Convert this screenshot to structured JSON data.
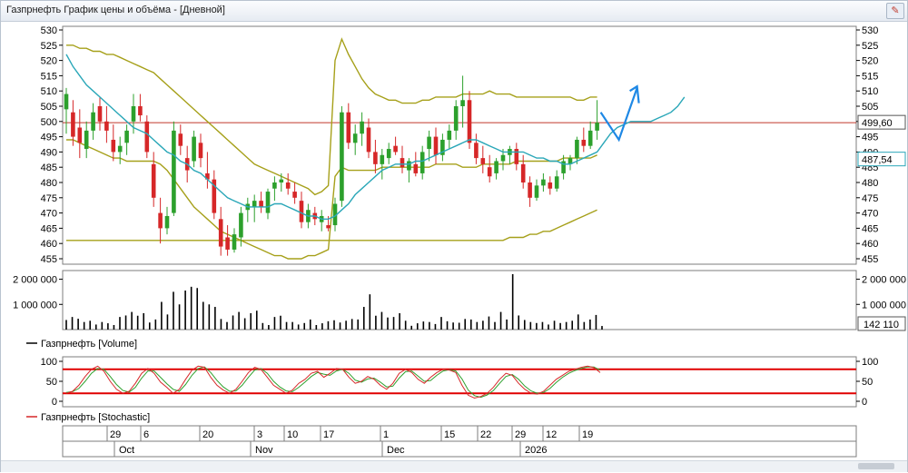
{
  "window": {
    "title": "Газпрнефть График цены и объёма - [Дневной]"
  },
  "colors": {
    "up": "#2ca02c",
    "down": "#d62728",
    "ma": "#2aa7b8",
    "bands": "#a6a01a",
    "price_line": "#c0392b",
    "stoch_k": "#d62728",
    "stoch_d": "#2ca02c",
    "stoch_levels": "#e00000",
    "arrow": "#1e88e5"
  },
  "chart_data": [
    {
      "type": "candlestick",
      "name": "price",
      "ylim": [
        455,
        530
      ],
      "y_ticks": [
        455,
        460,
        465,
        470,
        475,
        480,
        485,
        490,
        495,
        500,
        505,
        510,
        515,
        520,
        525,
        530
      ],
      "last_price_label": "499,60",
      "last_price": 499.6,
      "ma_label": "487,54",
      "ma_value": 487.54,
      "candles": [
        {
          "o": 504,
          "h": 511,
          "l": 496,
          "c": 509
        },
        {
          "o": 503,
          "h": 507,
          "l": 492,
          "c": 495
        },
        {
          "o": 498,
          "h": 504,
          "l": 488,
          "c": 493
        },
        {
          "o": 491,
          "h": 500,
          "l": 488,
          "c": 497
        },
        {
          "o": 497,
          "h": 506,
          "l": 494,
          "c": 503
        },
        {
          "o": 505,
          "h": 508,
          "l": 497,
          "c": 500
        },
        {
          "o": 500,
          "h": 505,
          "l": 493,
          "c": 497
        },
        {
          "o": 494,
          "h": 499,
          "l": 487,
          "c": 490
        },
        {
          "o": 490,
          "h": 495,
          "l": 486,
          "c": 492
        },
        {
          "o": 493,
          "h": 499,
          "l": 489,
          "c": 497
        },
        {
          "o": 500,
          "h": 509,
          "l": 496,
          "c": 505
        },
        {
          "o": 505,
          "h": 509,
          "l": 500,
          "c": 502
        },
        {
          "o": 500,
          "h": 502,
          "l": 488,
          "c": 490
        },
        {
          "o": 486,
          "h": 490,
          "l": 472,
          "c": 475
        },
        {
          "o": 470,
          "h": 475,
          "l": 460,
          "c": 465
        },
        {
          "o": 465,
          "h": 472,
          "l": 463,
          "c": 469
        },
        {
          "o": 470,
          "h": 500,
          "l": 469,
          "c": 497
        },
        {
          "o": 496,
          "h": 499,
          "l": 489,
          "c": 492
        },
        {
          "o": 488,
          "h": 492,
          "l": 480,
          "c": 484
        },
        {
          "o": 487,
          "h": 497,
          "l": 485,
          "c": 495
        },
        {
          "o": 493,
          "h": 496,
          "l": 485,
          "c": 488
        },
        {
          "o": 483,
          "h": 490,
          "l": 478,
          "c": 481
        },
        {
          "o": 481,
          "h": 484,
          "l": 468,
          "c": 470
        },
        {
          "o": 468,
          "h": 472,
          "l": 456,
          "c": 459
        },
        {
          "o": 462,
          "h": 466,
          "l": 456,
          "c": 458
        },
        {
          "o": 458,
          "h": 465,
          "l": 457,
          "c": 463
        },
        {
          "o": 462,
          "h": 472,
          "l": 459,
          "c": 470
        },
        {
          "o": 471,
          "h": 475,
          "l": 467,
          "c": 473
        },
        {
          "o": 472,
          "h": 476,
          "l": 467,
          "c": 474
        },
        {
          "o": 474,
          "h": 477,
          "l": 470,
          "c": 472
        },
        {
          "o": 470,
          "h": 478,
          "l": 468,
          "c": 477
        },
        {
          "o": 478,
          "h": 482,
          "l": 474,
          "c": 480
        },
        {
          "o": 480,
          "h": 483,
          "l": 477,
          "c": 481
        },
        {
          "o": 480,
          "h": 483,
          "l": 476,
          "c": 478
        },
        {
          "o": 477,
          "h": 480,
          "l": 473,
          "c": 475
        },
        {
          "o": 474,
          "h": 477,
          "l": 465,
          "c": 467
        },
        {
          "o": 467,
          "h": 473,
          "l": 465,
          "c": 471
        },
        {
          "o": 470,
          "h": 472,
          "l": 466,
          "c": 468
        },
        {
          "o": 467,
          "h": 471,
          "l": 464,
          "c": 469
        },
        {
          "o": 466,
          "h": 469,
          "l": 464,
          "c": 465
        },
        {
          "o": 466,
          "h": 475,
          "l": 464,
          "c": 473
        },
        {
          "o": 474,
          "h": 505,
          "l": 472,
          "c": 503
        },
        {
          "o": 503,
          "h": 506,
          "l": 491,
          "c": 493
        },
        {
          "o": 493,
          "h": 499,
          "l": 489,
          "c": 496
        },
        {
          "o": 496,
          "h": 503,
          "l": 492,
          "c": 500
        },
        {
          "o": 498,
          "h": 501,
          "l": 488,
          "c": 490
        },
        {
          "o": 490,
          "h": 494,
          "l": 483,
          "c": 486
        },
        {
          "o": 486,
          "h": 491,
          "l": 481,
          "c": 489
        },
        {
          "o": 488,
          "h": 493,
          "l": 486,
          "c": 491
        },
        {
          "o": 492,
          "h": 495,
          "l": 489,
          "c": 490
        },
        {
          "o": 488,
          "h": 492,
          "l": 483,
          "c": 485
        },
        {
          "o": 484,
          "h": 488,
          "l": 480,
          "c": 487
        },
        {
          "o": 486,
          "h": 490,
          "l": 482,
          "c": 483
        },
        {
          "o": 483,
          "h": 492,
          "l": 481,
          "c": 490
        },
        {
          "o": 491,
          "h": 497,
          "l": 487,
          "c": 495
        },
        {
          "o": 495,
          "h": 498,
          "l": 486,
          "c": 489
        },
        {
          "o": 489,
          "h": 496,
          "l": 487,
          "c": 494
        },
        {
          "o": 494,
          "h": 499,
          "l": 491,
          "c": 497
        },
        {
          "o": 497,
          "h": 507,
          "l": 494,
          "c": 505
        },
        {
          "o": 505,
          "h": 515,
          "l": 498,
          "c": 507
        },
        {
          "o": 507,
          "h": 510,
          "l": 491,
          "c": 493
        },
        {
          "o": 493,
          "h": 496,
          "l": 486,
          "c": 488
        },
        {
          "o": 488,
          "h": 492,
          "l": 483,
          "c": 486
        },
        {
          "o": 485,
          "h": 489,
          "l": 480,
          "c": 482
        },
        {
          "o": 483,
          "h": 488,
          "l": 481,
          "c": 487
        },
        {
          "o": 487,
          "h": 491,
          "l": 484,
          "c": 489
        },
        {
          "o": 489,
          "h": 492,
          "l": 486,
          "c": 491
        },
        {
          "o": 491,
          "h": 493,
          "l": 484,
          "c": 486
        },
        {
          "o": 486,
          "h": 489,
          "l": 478,
          "c": 480
        },
        {
          "o": 480,
          "h": 482,
          "l": 472,
          "c": 475
        },
        {
          "o": 475,
          "h": 481,
          "l": 474,
          "c": 479
        },
        {
          "o": 479,
          "h": 483,
          "l": 477,
          "c": 481
        },
        {
          "o": 480,
          "h": 482,
          "l": 476,
          "c": 478
        },
        {
          "o": 478,
          "h": 484,
          "l": 477,
          "c": 482
        },
        {
          "o": 483,
          "h": 489,
          "l": 481,
          "c": 487
        },
        {
          "o": 486,
          "h": 489,
          "l": 484,
          "c": 488
        },
        {
          "o": 488,
          "h": 495,
          "l": 486,
          "c": 494
        },
        {
          "o": 494,
          "h": 498,
          "l": 490,
          "c": 492
        },
        {
          "o": 492,
          "h": 500,
          "l": 491,
          "c": 497
        },
        {
          "o": 497,
          "h": 507,
          "l": 494,
          "c": 499.6
        }
      ],
      "ma": [
        522,
        518,
        515,
        512,
        510,
        508,
        506,
        504,
        502,
        500,
        498,
        497,
        496,
        494,
        492,
        490,
        489,
        487,
        486,
        484,
        483,
        481,
        479,
        477,
        475,
        474,
        473,
        472,
        472,
        472,
        472,
        473,
        473,
        472,
        471,
        470,
        469,
        469,
        468,
        468,
        469,
        471,
        473,
        476,
        478,
        480,
        482,
        484,
        485,
        486,
        486,
        486,
        487,
        487,
        488,
        489,
        490,
        491,
        492,
        493,
        494,
        494,
        493,
        492,
        491,
        490,
        490,
        490,
        490,
        489,
        488,
        488,
        487,
        487,
        486,
        486,
        487,
        488,
        489,
        490,
        493,
        496,
        498,
        499,
        500,
        500,
        500,
        500,
        501,
        502,
        503,
        505,
        508
      ],
      "upper_band": [
        525,
        525,
        524,
        524,
        523,
        523,
        522,
        522,
        521,
        520,
        519,
        518,
        517,
        516,
        514,
        512,
        510,
        508,
        506,
        504,
        502,
        500,
        498,
        496,
        494,
        492,
        490,
        488,
        486,
        485,
        484,
        483,
        482,
        481,
        480,
        479,
        478,
        476,
        477,
        479,
        520,
        527,
        522,
        518,
        514,
        511,
        509,
        508,
        507,
        507,
        506,
        506,
        506,
        507,
        507,
        508,
        508,
        508,
        508,
        509,
        509,
        509,
        509,
        510,
        509,
        509,
        509,
        508,
        508,
        508,
        508,
        508,
        508,
        508,
        508,
        508,
        507,
        507,
        508,
        508
      ],
      "lower_band": [
        494,
        494,
        493,
        492,
        491,
        490,
        489,
        488,
        488,
        487,
        487,
        487,
        487,
        487,
        486,
        484,
        481,
        478,
        475,
        472,
        470,
        468,
        466,
        464,
        463,
        462,
        461,
        460,
        459,
        458,
        457,
        456,
        456,
        455,
        455,
        455,
        456,
        456,
        457,
        458,
        482,
        485,
        484,
        484,
        484,
        484,
        484,
        485,
        485,
        485,
        485,
        485,
        485,
        485,
        485,
        486,
        486,
        486,
        486,
        485,
        485,
        485,
        486,
        486,
        486,
        486,
        486,
        487,
        487,
        487,
        487,
        487,
        487,
        487,
        488,
        488,
        488,
        488,
        488,
        489
      ],
      "bottom_band": [
        461,
        461,
        461,
        461,
        461,
        461,
        461,
        461,
        461,
        461,
        461,
        461,
        461,
        461,
        461,
        461,
        461,
        461,
        461,
        461,
        461,
        461,
        461,
        461,
        461,
        461,
        461,
        461,
        461,
        461,
        461,
        461,
        461,
        461,
        461,
        461,
        461,
        461,
        461,
        461,
        461,
        461,
        461,
        461,
        461,
        461,
        461,
        461,
        461,
        461,
        461,
        461,
        461,
        461,
        461,
        461,
        461,
        461,
        461,
        461,
        461,
        461,
        461,
        461,
        461,
        461,
        462,
        462,
        462,
        463,
        463,
        464,
        464,
        465,
        466,
        467,
        468,
        469,
        470,
        471
      ]
    },
    {
      "type": "bar",
      "name": "Газпрнефть [Volume]",
      "legend": "Газпрнефть [Volume]",
      "ylim": [
        0,
        2200000
      ],
      "y_ticks": [
        1000000,
        2000000
      ],
      "y_tick_labels": [
        "1 000 000",
        "2 000 000"
      ],
      "last_value_label": "142 110",
      "values": [
        380000,
        500000,
        430000,
        300000,
        350000,
        200000,
        300000,
        250000,
        180000,
        500000,
        560000,
        700000,
        550000,
        650000,
        280000,
        400000,
        1100000,
        600000,
        1500000,
        1000000,
        1550000,
        1700000,
        1650000,
        1100000,
        1000000,
        900000,
        420000,
        300000,
        560000,
        700000,
        450000,
        650000,
        750000,
        260000,
        180000,
        500000,
        550000,
        300000,
        300000,
        200000,
        260000,
        400000,
        180000,
        250000,
        330000,
        370000,
        280000,
        350000,
        420000,
        400000,
        900000,
        1400000,
        550000,
        700000,
        480000,
        500000,
        650000,
        350000,
        150000,
        250000,
        320000,
        300000,
        220000,
        500000,
        330000,
        280000,
        270000,
        420000,
        400000,
        300000,
        350000,
        520000,
        300000,
        700000,
        400000,
        2200000,
        560000,
        380000,
        300000,
        260000,
        300000,
        200000,
        350000,
        260000,
        300000,
        350000,
        600000,
        300000,
        400000,
        580000,
        142110
      ]
    },
    {
      "type": "line",
      "name": "Газпрнефть [Stochastic]",
      "legend": "Газпрнефть [Stochastic]",
      "ylim": [
        0,
        100
      ],
      "y_ticks": [
        0,
        50,
        100
      ],
      "levels": [
        20,
        80
      ],
      "k": [
        20,
        25,
        40,
        62,
        80,
        88,
        75,
        50,
        30,
        20,
        25,
        45,
        70,
        82,
        70,
        48,
        35,
        20,
        30,
        55,
        78,
        88,
        85,
        60,
        40,
        28,
        20,
        30,
        50,
        72,
        85,
        80,
        60,
        40,
        30,
        20,
        28,
        45,
        55,
        70,
        75,
        60,
        70,
        82,
        80,
        60,
        45,
        50,
        62,
        55,
        40,
        30,
        45,
        70,
        80,
        72,
        55,
        45,
        60,
        72,
        80,
        78,
        72,
        40,
        15,
        8,
        12,
        20,
        35,
        55,
        70,
        65,
        45,
        30,
        20,
        18,
        25,
        40,
        55,
        65,
        75,
        80,
        85,
        88,
        84,
        72
      ],
      "d": [
        22,
        24,
        32,
        50,
        70,
        82,
        80,
        62,
        42,
        27,
        23,
        35,
        58,
        76,
        76,
        60,
        44,
        30,
        25,
        42,
        65,
        82,
        86,
        72,
        52,
        36,
        25,
        26,
        40,
        60,
        78,
        82,
        70,
        50,
        36,
        26,
        24,
        35,
        48,
        62,
        72,
        68,
        65,
        76,
        80,
        70,
        53,
        48,
        56,
        58,
        48,
        36,
        38,
        58,
        74,
        76,
        63,
        50,
        52,
        65,
        76,
        79,
        76,
        56,
        28,
        14,
        10,
        16,
        27,
        45,
        62,
        67,
        55,
        38,
        26,
        20,
        22,
        32,
        47,
        60,
        70,
        77,
        82,
        86,
        86,
        78
      ]
    },
    {
      "type": "axis",
      "name": "dates",
      "day_labels": [
        "29",
        "6",
        "20",
        "3",
        "10",
        "17",
        "1",
        "15",
        "22",
        "29",
        "12",
        "19"
      ],
      "month_labels": [
        "Oct",
        "Nov",
        "Dec",
        "2026"
      ]
    }
  ]
}
